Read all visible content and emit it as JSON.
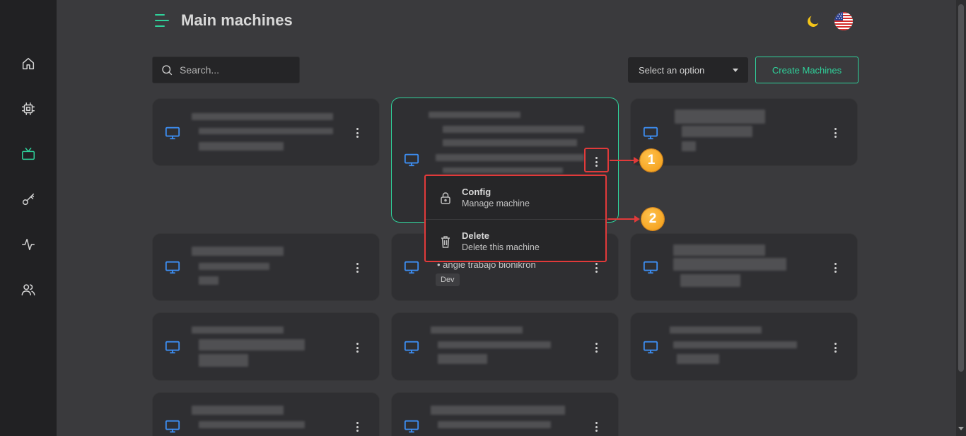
{
  "header": {
    "title": "Main machines",
    "theme_icon": "moon-icon",
    "language_icon": "us-flag-icon"
  },
  "toolbar": {
    "search_placeholder": "Search...",
    "select_label": "Select an option",
    "create_label": "Create Machines"
  },
  "sidebar": {
    "items": [
      {
        "icon": "home-icon",
        "active": false
      },
      {
        "icon": "cpu-icon",
        "active": false
      },
      {
        "icon": "tv-icon",
        "active": true
      },
      {
        "icon": "key-icon",
        "active": false
      },
      {
        "icon": "activity-icon",
        "active": false
      },
      {
        "icon": "users-icon",
        "active": false
      }
    ]
  },
  "card_visible": {
    "bullet_text": "• angie trabajo bionikron",
    "badge": "Dev"
  },
  "dropdown": {
    "config_title": "Config",
    "config_sub": "Manage machine",
    "delete_title": "Delete",
    "delete_sub": "Delete this machine"
  },
  "annotations": {
    "step1": "1",
    "step2": "2"
  },
  "colors": {
    "accent": "#2fd29b",
    "machine_icon": "#3d8ef2",
    "highlight": "#e13a3a",
    "callout": "#f29a13"
  }
}
